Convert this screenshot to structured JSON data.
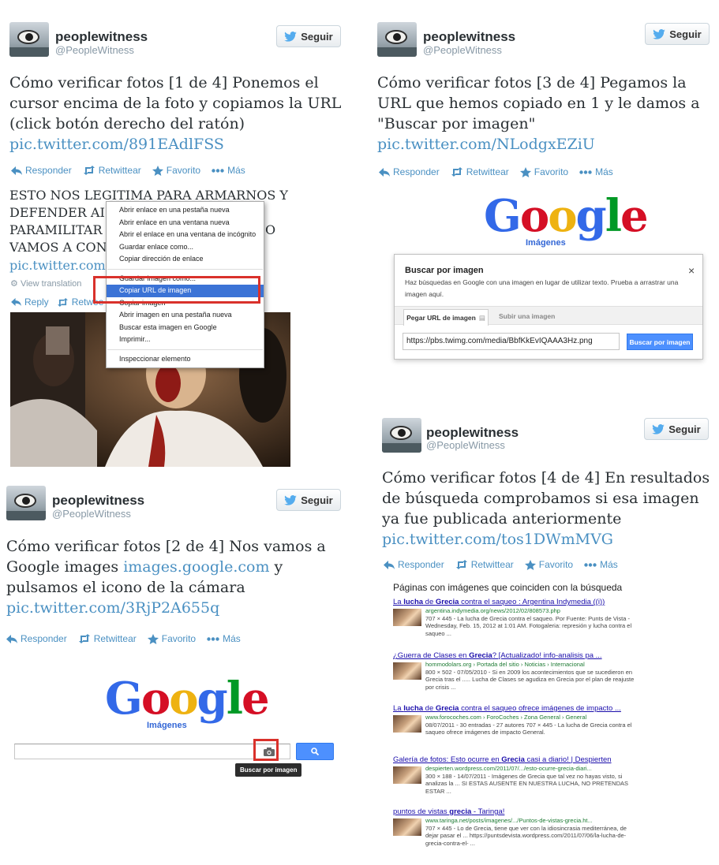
{
  "user": {
    "name": "peoplewitness",
    "handle": "@PeopleWitness",
    "follow_label": "Seguir"
  },
  "actions": {
    "reply": "Responder",
    "retweet": "Retwittear",
    "favorite": "Favorito",
    "more": "Más"
  },
  "tweet1": {
    "text": "Cómo verificar fotos [1 de 4] Ponemos el cursor encima de la foto y copiamos la URL (click botón derecho del ratón)",
    "link": "pic.twitter.com/891EAdlFSS",
    "quoted": {
      "line1": "ESTO NOS LEGITIMA PARA ARMARNOS Y",
      "line2": "DEFENDER AI",
      "line3": "PARAMILITAR",
      "line3_tail": "O",
      "line4": "VAMOS A CON",
      "link": "pic.twitter.com,",
      "view_translation": "View translation",
      "reply": "Reply",
      "retweet": "Retwee"
    },
    "context_menu": [
      "Abrir enlace en una pestaña nueva",
      "Abrir enlace en una ventana nueva",
      "Abrir el enlace en una ventana de incógnito",
      "Guardar enlace como...",
      "Copiar dirección de enlace",
      "Guardar imagen como...",
      "Copiar URL de imagen",
      "Copiar imagen",
      "Abrir imagen en una pestaña nueva",
      "Buscar esta imagen en Google",
      "Imprimir...",
      "Inspeccionar elemento"
    ]
  },
  "tweet2": {
    "text_before": "Cómo verificar fotos [2 de 4] Nos vamos a Google images ",
    "inline_link": "images.google.com",
    "text_after": " y pulsamos el icono de la cámara",
    "link": "pic.twitter.com/3RjP2A655q",
    "google_logo": "Google",
    "google_sub": "Imágenes",
    "tooltip": "Buscar por imagen"
  },
  "tweet3": {
    "text": "Cómo verificar fotos [3 de 4] Pegamos la URL que hemos copiado en 1 y le damos a \"Buscar por imagen\"",
    "link": "pic.twitter.com/NLodgxEZiU",
    "google_logo": "Google",
    "google_sub": "Imágenes",
    "dialog": {
      "title": "Buscar por imagen",
      "close": "×",
      "description": "Haz búsquedas en Google con una imagen en lugar de utilizar texto. Prueba a arrastrar una imagen aquí.",
      "tab_paste": "Pegar URL de imagen",
      "tab_upload": "Subir una imagen",
      "url_value": "https://pbs.twimg.com/media/BbfKkEvIQAAA3Hz.png",
      "search_button": "Buscar por imagen"
    }
  },
  "tweet4": {
    "text": "Cómo verificar fotos [4 de 4] En resultados de búsqueda comprobamos si esa imagen ya fue publicada anteriormente",
    "link": "pic.twitter.com/tos1DWmMVG",
    "results_title": "Páginas con imágenes que coinciden con la búsqueda",
    "results": [
      {
        "title_a": "La ",
        "title_b": "lucha",
        "title_c": " de ",
        "title_d": "Grecia",
        "title_e": " contra el saqueo : Argentina Indymedia ((i))",
        "url": "argentina.indymedia.org/news/2012/02/808573.php",
        "desc": "707 × 445 - La lucha de Grecia contra el saqueo. Por Fuente: Punts de Vista - Wednesday, Feb. 15, 2012 at 1:01 AM. Fotogaleria: represión y lucha contra el saqueo ..."
      },
      {
        "title_a": "¿Guerra de Clases en ",
        "title_b": "Grecia",
        "title_c": "? [Actualizado! info-analisis pa ...",
        "title_d": "",
        "title_e": "",
        "url": "hommodolars.org › Portada del sitio › Noticias › Internacional",
        "desc": "800 × 502 - 07/05/2010 - Si en 2009 los acontecimientos que se sucedieron en Grecia tras el ..... Lucha de Clases se agudiza en Grecia por el plan de reajuste por crisis ..."
      },
      {
        "title_a": "La ",
        "title_b": "lucha",
        "title_c": " de ",
        "title_d": "Grecia",
        "title_e": " contra el saqueo ofrece imágenes de impacto ...",
        "url": "www.forocoches.com › ForoCoches › Zona General › General",
        "desc": "08/07/2011 - 30 entradas - 27 autores 707 × 445 - La lucha de Grecia contra el saqueo ofrece imágenes de impacto General."
      },
      {
        "title_a": "Galería de fotos: Esto ocurre en ",
        "title_b": "Grecia",
        "title_c": " casi a diario! | Despierten",
        "title_d": "",
        "title_e": "",
        "url": "despierten.wordpress.com/2011/07/.../esto-ocurre-grecia-diari...",
        "desc": "300 × 188 - 14/07/2011 - Imágenes de Grecia que tal vez no hayas visto, si analizas la ... SI ESTAS AUSENTE EN NUESTRA LUCHA, NO PRETENDAS ESTAR ..."
      },
      {
        "title_a": "puntos de vistas ",
        "title_b": "grecia",
        "title_c": " - Taringa!",
        "title_d": "",
        "title_e": "",
        "url": "www.taringa.net/posts/imagenes/.../Puntos-de-vistas-grecia.ht...",
        "desc": "707 × 445 - Lo de Grecia, tiene que ver con la idiosincrasia mediterránea, de dejar pasar el ... https://puntsdevista.wordpress.com/2011/07/06/la-lucha-de-grecia-contra-el- ..."
      }
    ]
  }
}
